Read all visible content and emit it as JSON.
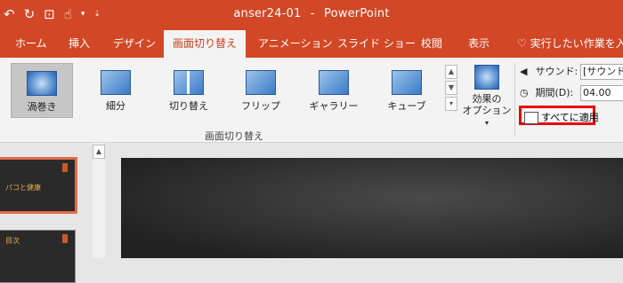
{
  "window": {
    "file_name": "anser24-01",
    "separator": "-",
    "app_name": "PowerPoint"
  },
  "qat": {
    "undo_icon": "↶",
    "redo_icon": "↻",
    "present_icon": "⊡",
    "touch_icon": "☝",
    "dropdown_icon": "▾",
    "customize_icon": "⇣"
  },
  "tabs": [
    "ホーム",
    "挿入",
    "デザイン",
    "画面切り替え",
    "アニメーション",
    "スライド ショー",
    "校閲",
    "表示"
  ],
  "tell_me": {
    "icon": "♡",
    "text": "実行したい作業を入力"
  },
  "transitions": [
    {
      "label": "渦巻き",
      "selected": true
    },
    {
      "label": "細分",
      "selected": false
    },
    {
      "label": "切り替え",
      "selected": false
    },
    {
      "label": "フリップ",
      "selected": false
    },
    {
      "label": "ギャラリー",
      "selected": false
    },
    {
      "label": "キューブ",
      "selected": false
    }
  ],
  "gallery_scroll": {
    "up": "▲",
    "down": "▼",
    "more": "▾"
  },
  "group_label": "画面切り替え",
  "effect_options": {
    "line1": "効果の",
    "line2": "オプション",
    "arrow": "▾"
  },
  "timing": {
    "sound_label": "サウンド:",
    "sound_value": "[サウンドなし]",
    "duration_label": "期間(D):",
    "duration_value": "04.00",
    "apply_all_label": "すべてに適用"
  },
  "slides": [
    {
      "title": "パコと健康"
    },
    {
      "title": "目次"
    }
  ]
}
